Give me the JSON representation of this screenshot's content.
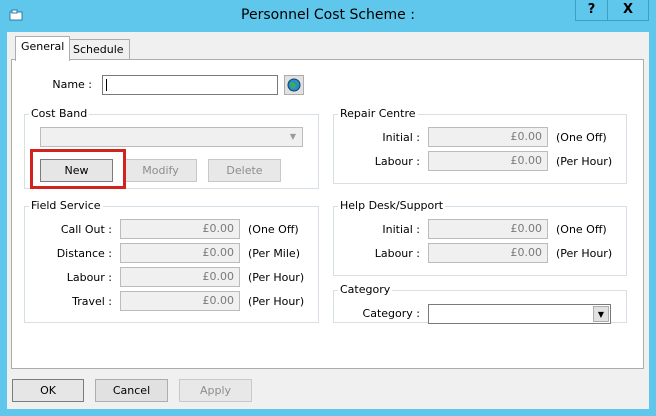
{
  "window": {
    "title": "Personnel Cost Scheme :",
    "help_label": "?",
    "close_label": "X"
  },
  "tabs": [
    {
      "label": "General",
      "active": true
    },
    {
      "label": "Schedule",
      "active": false
    }
  ],
  "name": {
    "label": "Name :",
    "value": ""
  },
  "cost_band": {
    "group_label": "Cost Band",
    "selected": "",
    "new_label": "New",
    "modify_label": "Modify",
    "delete_label": "Delete"
  },
  "repair_centre": {
    "group_label": "Repair Centre",
    "rows": [
      {
        "label": "Initial :",
        "value": "£0.00",
        "unit": "(One Off)"
      },
      {
        "label": "Labour :",
        "value": "£0.00",
        "unit": "(Per Hour)"
      }
    ]
  },
  "field_service": {
    "group_label": "Field Service",
    "rows": [
      {
        "label": "Call Out :",
        "value": "£0.00",
        "unit": "(One Off)"
      },
      {
        "label": "Distance :",
        "value": "£0.00",
        "unit": "(Per Mile)"
      },
      {
        "label": "Labour :",
        "value": "£0.00",
        "unit": "(Per Hour)"
      },
      {
        "label": "Travel :",
        "value": "£0.00",
        "unit": "(Per Hour)"
      }
    ]
  },
  "help_desk": {
    "group_label": "Help Desk/Support",
    "rows": [
      {
        "label": "Initial :",
        "value": "£0.00",
        "unit": "(One Off)"
      },
      {
        "label": "Labour :",
        "value": "£0.00",
        "unit": "(Per Hour)"
      }
    ]
  },
  "category": {
    "group_label": "Category",
    "label": "Category :",
    "selected": ""
  },
  "footer": {
    "ok_label": "OK",
    "cancel_label": "Cancel",
    "apply_label": "Apply"
  },
  "colors": {
    "title_bar": "#5fc6ec",
    "highlight": "#d2231f"
  }
}
